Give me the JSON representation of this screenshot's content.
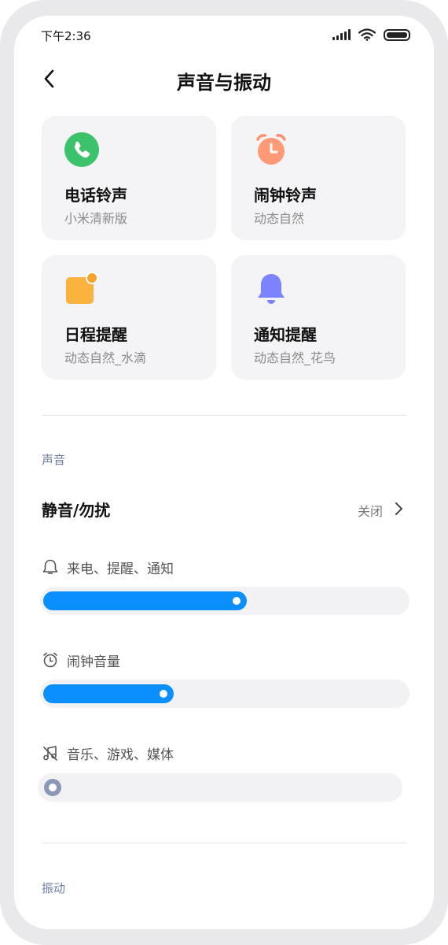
{
  "status_bar": {
    "time": "下午2:36"
  },
  "header": {
    "title": "声音与振动"
  },
  "cards": [
    {
      "title": "电话铃声",
      "subtitle": "小米清新版",
      "icon": "phone-icon",
      "color": "#3cc26a"
    },
    {
      "title": "闹钟铃声",
      "subtitle": "动态自然",
      "icon": "alarm-clock-icon",
      "color": "#ff8f6b"
    },
    {
      "title": "日程提醒",
      "subtitle": "动态自然_水滴",
      "icon": "calendar-icon",
      "color": "#f9b23c"
    },
    {
      "title": "通知提醒",
      "subtitle": "动态自然_花鸟",
      "icon": "bell-icon",
      "color": "#7b83ff"
    }
  ],
  "sound_section": {
    "label": "声音",
    "dnd": {
      "title": "静音/勿扰",
      "value": "关闭"
    },
    "sliders": [
      {
        "label": "来电、提醒、通知",
        "icon": "bell-outline-icon",
        "level": 0.56
      },
      {
        "label": "闹钟音量",
        "icon": "alarm-outline-icon",
        "level": 0.36
      },
      {
        "label": "音乐、游戏、媒体",
        "icon": "music-muted-icon",
        "level": 0
      }
    ]
  },
  "vibration_section": {
    "label": "振动"
  },
  "colors": {
    "accent": "#0b8ffd",
    "card_bg": "#f4f4f7",
    "section_label": "#6d7da3"
  }
}
